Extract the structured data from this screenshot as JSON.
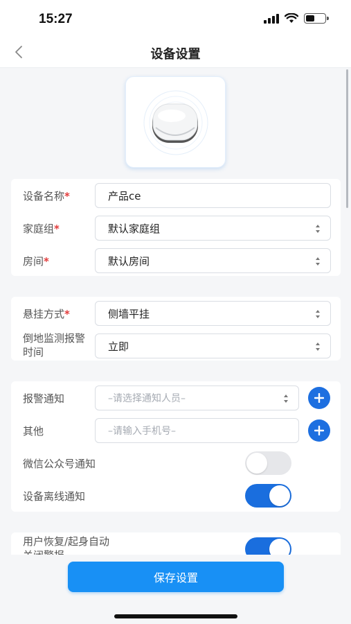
{
  "status": {
    "time": "15:27",
    "battery_level": 0.45
  },
  "nav": {
    "title": "设备设置",
    "back_icon": "chevron-left-icon"
  },
  "basic": {
    "name_label": "设备名称",
    "name_value": "产品ce",
    "family_label": "家庭组",
    "family_value": "默认家庭组",
    "room_label": "房间",
    "room_value": "默认房间"
  },
  "install": {
    "mount_label": "悬挂方式",
    "mount_value": "侧墙平挂",
    "fall_label": "倒地监测报警时间",
    "fall_value": "立即"
  },
  "notify": {
    "alarm_label": "报警通知",
    "alarm_placeholder": "–请选择通知人员–",
    "other_label": "其他",
    "other_placeholder": "–请输入手机号–",
    "wechat_label": "微信公众号通知",
    "wechat_on": false,
    "offline_label": "设备离线通知",
    "offline_on": true
  },
  "recover": {
    "label": "用户恢复/起身自动关闭警报",
    "on": true
  },
  "footer": {
    "save_label": "保存设置"
  },
  "colors": {
    "accent": "#1890f5",
    "toggle_on": "#1a6ede",
    "required": "#e23b3b"
  }
}
